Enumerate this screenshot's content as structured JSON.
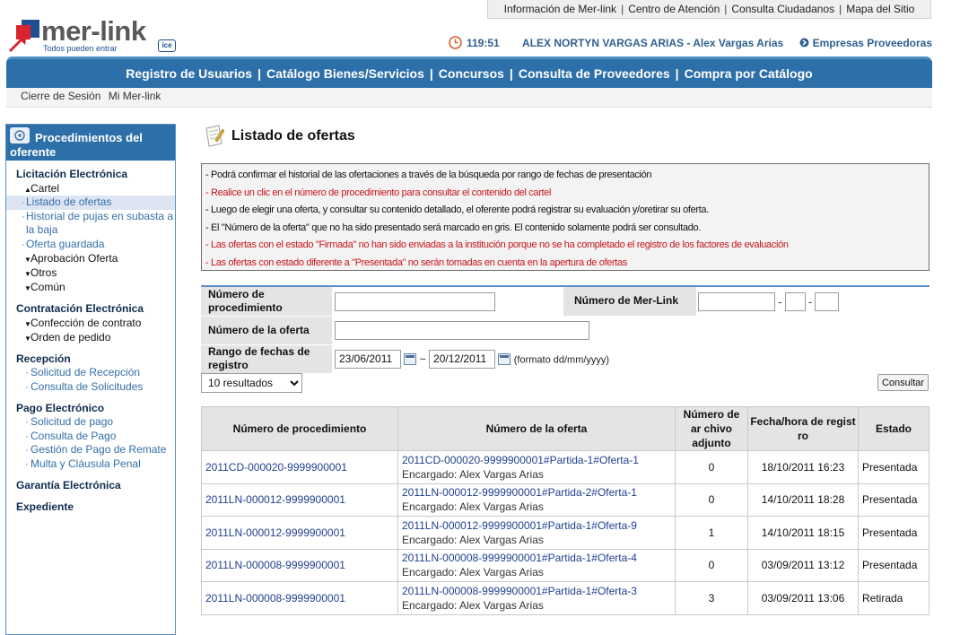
{
  "top_links": [
    "Información de Mer-link",
    "Centro de Atención",
    "Consulta Ciudadanos",
    "Mapa del Sitio"
  ],
  "top_links_separator": "|",
  "logo": {
    "word": "mer-link",
    "tagline": "Todos pueden entrar",
    "badge": "ice"
  },
  "user_line": {
    "time": "119:51",
    "user": "ALEX NORTYN VARGAS ARIAS - Alex Vargas Arias",
    "providers_link": "Empresas Proveedoras"
  },
  "nav": [
    "Registro de Usuarios",
    "Catálogo Bienes/Servicios",
    "Concursos",
    "Consulta de Proveedores",
    "Compra por Catálogo"
  ],
  "nav_separator": "|",
  "subnav": [
    "Cierre de Sesión",
    "Mi Mer-link"
  ],
  "sidebar": {
    "title_line1": "Procedimientos del",
    "title_line2": "oferente",
    "sections": [
      {
        "label": "Licitación Electrónica",
        "cartel": "Cartel",
        "leaves": [
          "Listado de ofertas",
          "Historial de pujas en subasta a la baja",
          "Oferta guardada"
        ],
        "subs": [
          "Aprobación Oferta",
          "Otros",
          "Común"
        ]
      },
      {
        "label": "Contratación Electrónica",
        "subs": [
          "Confección de contrato",
          "Orden de pedido"
        ]
      },
      {
        "label": "Recepción",
        "leaves": [
          "Solicitud de Recepción",
          "Consulta de Solicitudes"
        ]
      },
      {
        "label": "Pago Electrónico",
        "leaves": [
          "Solicitud de pago",
          "Consulta de Pago",
          "Gestión de Pago de Remate",
          "Multa y Cláusula Penal"
        ]
      },
      {
        "label": "Garantía Electrónica"
      },
      {
        "label": "Expediente"
      }
    ]
  },
  "page_title": "Listado de ofertas",
  "notes": [
    {
      "text": "- Podrá confirmar el historial de las ofertaciones a través de la búsqueda por rango de fechas de presentación",
      "color": "dark"
    },
    {
      "text": "- Realice un clic en el número de procedimiento para consultar el contenido del cartel",
      "color": "red"
    },
    {
      "text": "- Luego de elegir una oferta, y consultar su contenido detallado, el oferente podrá registrar su evaluación y/oretirar su oferta.",
      "color": "dark"
    },
    {
      "text": "- El \"Número de la oferta\" que no ha sido presentado será marcado en gris. El contenido solamente podrá ser consultado.",
      "color": "dark"
    },
    {
      "text": "- Las ofertas con el estado \"Firmada\" no han sido enviadas a la institución porque no se ha completado el registro de los factores de evaluación",
      "color": "red"
    },
    {
      "text": "- Las ofertas con estado diferente a \"Presentada\" no serán tomadas en cuenta en la apertura de ofertas",
      "color": "red"
    }
  ],
  "form": {
    "proc_label": "Número de procedimiento",
    "proc_value": "",
    "merlink_label": "Número de Mer-Link",
    "merlink_values": [
      "",
      "",
      ""
    ],
    "merlink_dash": "-",
    "oferta_label": "Número de la oferta",
    "oferta_value": "",
    "fechas_label": "Rango de fechas de registro",
    "fecha_desde": "23/06/2011",
    "fecha_hasta": "20/12/2011",
    "fecha_tilde": "~",
    "formato": "(formato dd/mm/yyyy)"
  },
  "results_select": "10 resultados",
  "consultar_button": "Consultar",
  "table": {
    "headers": [
      "Número de procedimiento",
      "Número de la oferta",
      "Número de ar chivo adjunto",
      "Fecha/hora de regist ro",
      "Estado"
    ],
    "rows": [
      {
        "proc": "2011CD-000020-9999900001",
        "oferta": "2011CD-000020-9999900001#Partida-1#Oferta-1",
        "encargado": "Encargado: Alex Vargas Arias",
        "adjuntos": "0",
        "fecha": "18/10/2011 16:23",
        "estado": "Presentada"
      },
      {
        "proc": "2011LN-000012-9999900001",
        "oferta": "2011LN-000012-9999900001#Partida-2#Oferta-1",
        "encargado": "Encargado: Alex Vargas Arias",
        "adjuntos": "0",
        "fecha": "14/10/2011 18:28",
        "estado": "Presentada"
      },
      {
        "proc": "2011LN-000012-9999900001",
        "oferta": "2011LN-000012-9999900001#Partida-1#Oferta-9",
        "encargado": "Encargado: Alex Vargas Arias",
        "adjuntos": "1",
        "fecha": "14/10/2011 18:15",
        "estado": "Presentada"
      },
      {
        "proc": "2011LN-000008-9999900001",
        "oferta": "2011LN-000008-9999900001#Partida-1#Oferta-4",
        "encargado": "Encargado: Alex Vargas Arias",
        "adjuntos": "0",
        "fecha": "03/09/2011 13:12",
        "estado": "Presentada"
      },
      {
        "proc": "2011LN-000008-9999900001",
        "oferta": "2011LN-000008-9999900001#Partida-1#Oferta-3",
        "encargado": "Encargado: Alex Vargas Arias",
        "adjuntos": "3",
        "fecha": "03/09/2011 13:06",
        "estado": "Retirada"
      }
    ]
  },
  "colors": {
    "nav_blue": "#2d6fa8",
    "note_red": "#c8141a",
    "link_blue": "#1f3f8f"
  },
  "icons": [
    "merlink-arrow-icon",
    "clock-icon",
    "arrow-circle-icon",
    "sidebar-procedures-icon",
    "notepad-icon",
    "calendar-icon",
    "dropdown-arrow-icon"
  ]
}
